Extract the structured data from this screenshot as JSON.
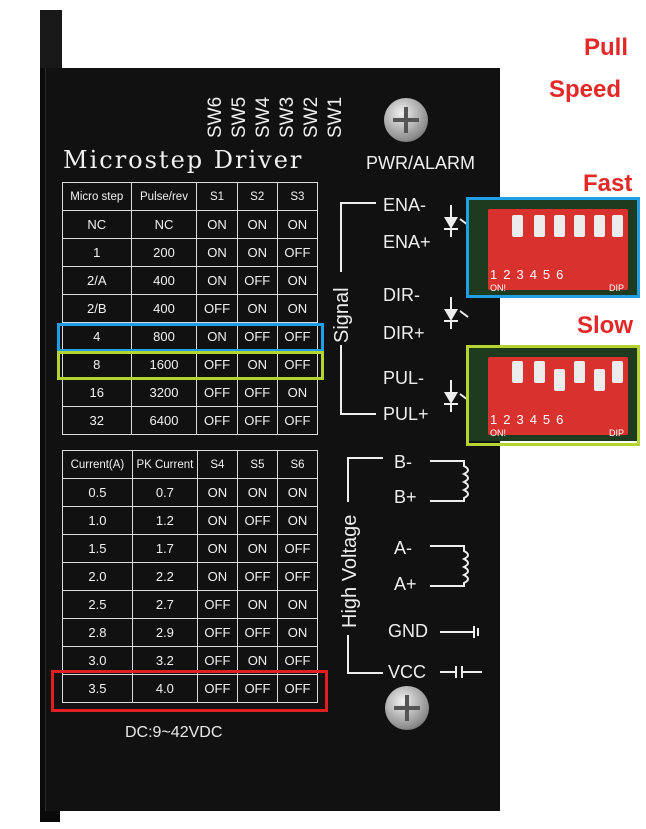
{
  "labels": {
    "pull": "Pull",
    "speed": "Speed",
    "fast": "Fast",
    "slow": "Slow",
    "title": "Microstep Driver",
    "pwr": "PWR/ALARM",
    "dc": "DC:9~42VDC",
    "signal": "Signal",
    "high_voltage": "High Voltage"
  },
  "sw_labels": [
    "SW6",
    "SW5",
    "SW4",
    "SW3",
    "SW2",
    "SW1"
  ],
  "microstep_table": {
    "headers": [
      "Micro step",
      "Pulse/rev",
      "S1",
      "S2",
      "S3"
    ],
    "rows": [
      [
        "NC",
        "NC",
        "ON",
        "ON",
        "ON"
      ],
      [
        "1",
        "200",
        "ON",
        "ON",
        "OFF"
      ],
      [
        "2/A",
        "400",
        "ON",
        "OFF",
        "ON"
      ],
      [
        "2/B",
        "400",
        "OFF",
        "ON",
        "ON"
      ],
      [
        "4",
        "800",
        "ON",
        "OFF",
        "OFF"
      ],
      [
        "8",
        "1600",
        "OFF",
        "ON",
        "OFF"
      ],
      [
        "16",
        "3200",
        "OFF",
        "OFF",
        "ON"
      ],
      [
        "32",
        "6400",
        "OFF",
        "OFF",
        "OFF"
      ]
    ]
  },
  "current_table": {
    "headers": [
      "Current(A)",
      "PK Current",
      "S4",
      "S5",
      "S6"
    ],
    "rows": [
      [
        "0.5",
        "0.7",
        "ON",
        "ON",
        "ON"
      ],
      [
        "1.0",
        "1.2",
        "ON",
        "OFF",
        "ON"
      ],
      [
        "1.5",
        "1.7",
        "ON",
        "ON",
        "OFF"
      ],
      [
        "2.0",
        "2.2",
        "ON",
        "OFF",
        "OFF"
      ],
      [
        "2.5",
        "2.7",
        "OFF",
        "ON",
        "ON"
      ],
      [
        "2.8",
        "2.9",
        "OFF",
        "OFF",
        "ON"
      ],
      [
        "3.0",
        "3.2",
        "OFF",
        "ON",
        "OFF"
      ],
      [
        "3.5",
        "4.0",
        "OFF",
        "OFF",
        "OFF"
      ]
    ]
  },
  "terminals": {
    "ena_minus": "ENA-",
    "ena_plus": "ENA+",
    "dir_minus": "DIR-",
    "dir_plus": "DIR+",
    "pul_minus": "PUL-",
    "pul_plus": "PUL+",
    "b_minus": "B-",
    "b_plus": "B+",
    "a_minus": "A-",
    "a_plus": "A+",
    "gnd": "GND",
    "vcc": "VCC"
  },
  "dip": {
    "numbers": "123456",
    "on": "ON!",
    "dip": "DIP"
  },
  "colors": {
    "highlight_blue": "#1fa0e6",
    "highlight_green": "#b6d42f",
    "highlight_red": "#e02020",
    "label_red": "#e32828"
  }
}
